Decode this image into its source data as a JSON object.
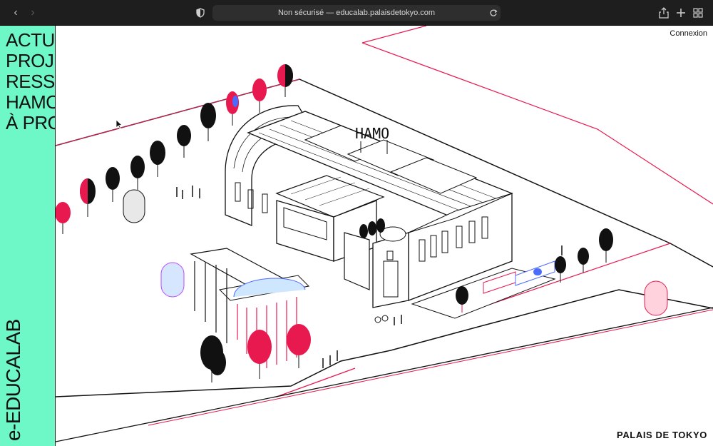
{
  "browser": {
    "address": "Non sécurisé — educalab.palaisdetokyo.com",
    "back_icon": "chevron-left-icon",
    "forward_icon": "chevron-right-icon"
  },
  "sidebar": {
    "menu": [
      "ACTU",
      "PROJ",
      "RESS",
      "HAMO",
      "À PRO"
    ],
    "brand": "e-EDUCALAB"
  },
  "header": {
    "login_label": "Connexion"
  },
  "map": {
    "building_sign": "HAMO"
  },
  "footer": {
    "logo": "PALAIS DE TOKYO"
  },
  "colors": {
    "mint": "#6ef7c7",
    "accent_red": "#e8194f",
    "accent_blue": "#4b6bff"
  }
}
